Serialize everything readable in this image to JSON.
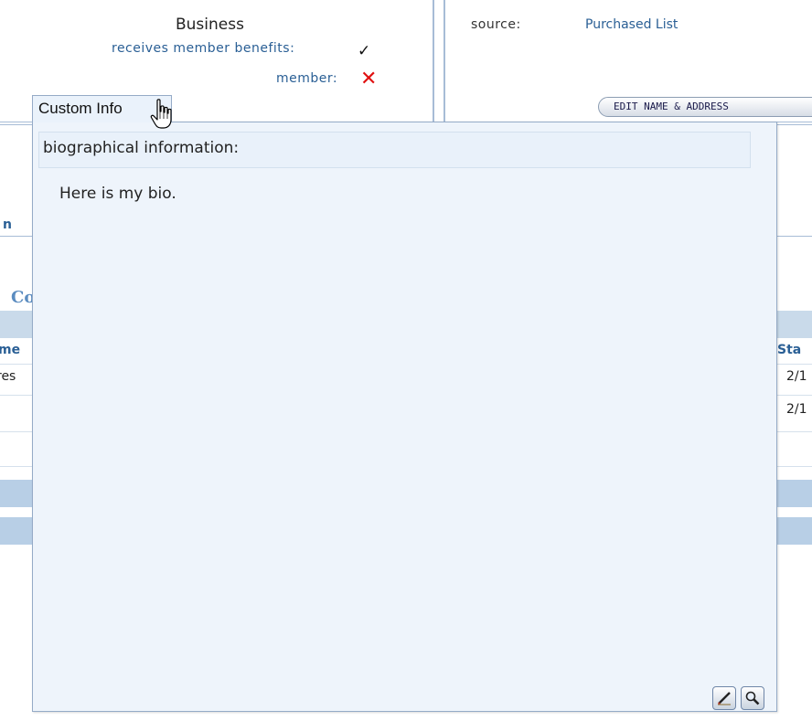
{
  "record": {
    "org_type": "Business",
    "receives_benefits_label": "receives member benefits:",
    "receives_benefits_mark": "✓",
    "member_label": "member:",
    "member_mark": "✕",
    "source_label": "source:",
    "source_value": "Purchased List",
    "edit_button": "EDIT NAME & ADDRESS"
  },
  "background_fragments": {
    "left_link": "n",
    "section_title": "Co",
    "col_header_left": "me",
    "row1_left": "res",
    "col_header_right": "Sta",
    "row1_right": "2/1",
    "row2_right": "2/1"
  },
  "custom_info": {
    "tab_label": "Custom Info",
    "field_label": "biographical information:",
    "field_value": "Here is my bio."
  },
  "colors": {
    "link": "#2a5f95",
    "border": "#a7bcd6",
    "popup_bg": "#eef4fb",
    "error_x": "#e01010"
  },
  "icons": [
    "check-icon",
    "x-icon",
    "hand-cursor-icon",
    "edit-icon",
    "magnifier-icon"
  ]
}
